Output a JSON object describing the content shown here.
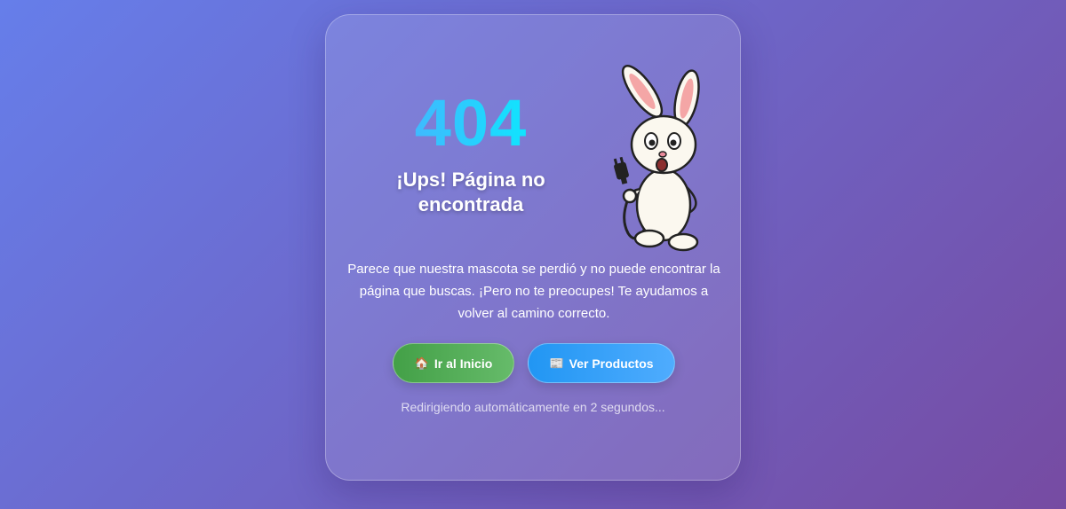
{
  "error": {
    "code": "404",
    "title": "¡Ups! Página no encontrada",
    "message": "Parece que nuestra mascota se perdió y no puede encontrar la página que buscas. ¡Pero no te preocupes! Te ayudamos a volver al camino correcto."
  },
  "actions": {
    "home": {
      "icon": "🏠",
      "label": "Ir al Inicio"
    },
    "products": {
      "icon": "📰",
      "label": "Ver Productos"
    }
  },
  "redirect": {
    "text": "Redirigiendo automáticamente en 2 segundos..."
  },
  "colors": {
    "background_start": "#667eea",
    "background_end": "#764ba2",
    "code_gradient_start": "#4facfe",
    "code_gradient_end": "#00f2fe",
    "home_button": "#4caf50",
    "products_button": "#2196f3"
  },
  "mascot": {
    "icon": "bunny-holding-unplugged-cable"
  }
}
